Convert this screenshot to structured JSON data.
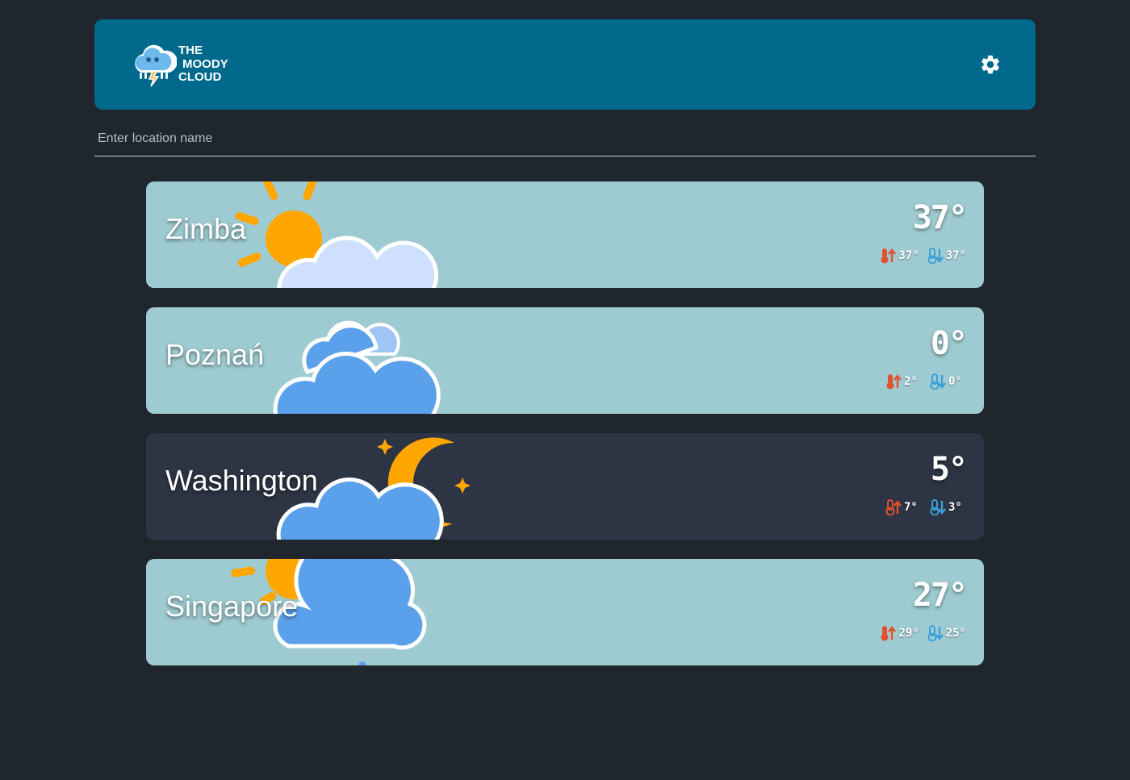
{
  "app": {
    "logo_lines": [
      "THE",
      "MOODY",
      "CLOUD"
    ],
    "settings_icon": "gear-icon"
  },
  "search": {
    "placeholder": "Enter location name",
    "value": ""
  },
  "colors": {
    "header": "#00698c",
    "background": "#20262e",
    "card_day": "#9ecbd1",
    "card_night": "#2d3444",
    "sun": "#ffa600",
    "cloud_light": "#cfe0ff",
    "cloud_blue": "#5aa0ea",
    "temp_high": "#e0522f",
    "temp_low": "#3aa0d8"
  },
  "cities": [
    {
      "name": "Zimba",
      "temp": "37°",
      "high": "37°",
      "low": "37°",
      "theme": "day",
      "icon": "sun-behind-cloud-icon"
    },
    {
      "name": "Poznań",
      "temp": "0°",
      "high": "2°",
      "low": "0°",
      "theme": "day",
      "icon": "overcast-clouds-icon"
    },
    {
      "name": "Washington",
      "temp": "5°",
      "high": "7°",
      "low": "3°",
      "theme": "night",
      "icon": "moon-behind-cloud-icon"
    },
    {
      "name": "Singapore",
      "temp": "27°",
      "high": "29°",
      "low": "25°",
      "theme": "day",
      "icon": "sun-behind-cloud-icon"
    }
  ]
}
